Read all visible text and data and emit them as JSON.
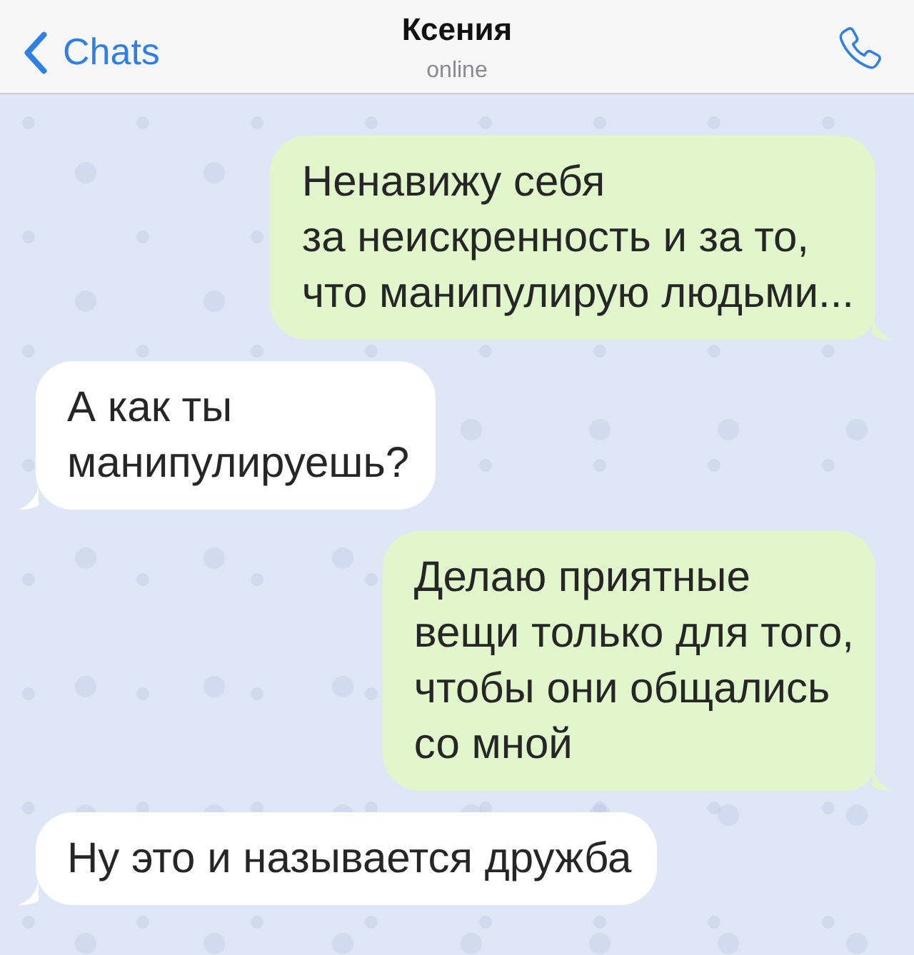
{
  "header": {
    "back_label": "Chats",
    "title": "Ксения",
    "status": "online"
  },
  "messages": [
    {
      "kind": "outgoing",
      "text": "Ненавижу себя\nза неискренность и за то,\nчто манипулирую людьми..."
    },
    {
      "kind": "incoming",
      "text": "А как ты\nманипулируешь?"
    },
    {
      "kind": "outgoing",
      "text": "Делаю приятные\nвещи только для того,\nчтобы они общались\nсо мной"
    },
    {
      "kind": "incoming",
      "text": "Ну это и называется дружба"
    }
  ]
}
